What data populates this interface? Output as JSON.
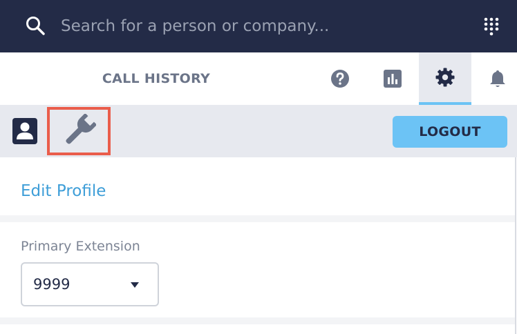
{
  "search": {
    "placeholder": "Search for a person or company..."
  },
  "tabs": {
    "call_history": "CALL HISTORY",
    "icons": [
      "help-icon",
      "stats-icon",
      "gear-icon",
      "bell-icon"
    ],
    "active": "settings"
  },
  "toolbar": {
    "icons": [
      "profile-icon",
      "wrench-icon"
    ],
    "logout_label": "LOGOUT"
  },
  "edit_profile": {
    "title": "Edit Profile"
  },
  "extension": {
    "label": "Primary Extension",
    "value": "9999"
  },
  "colors": {
    "navy": "#232b47",
    "accent_blue": "#6cc3f5",
    "link_blue": "#3e9ed8",
    "highlight_red": "#ea5d4b",
    "toolbar_gray": "#e7e9ef",
    "icon_gray": "#6b7488"
  }
}
